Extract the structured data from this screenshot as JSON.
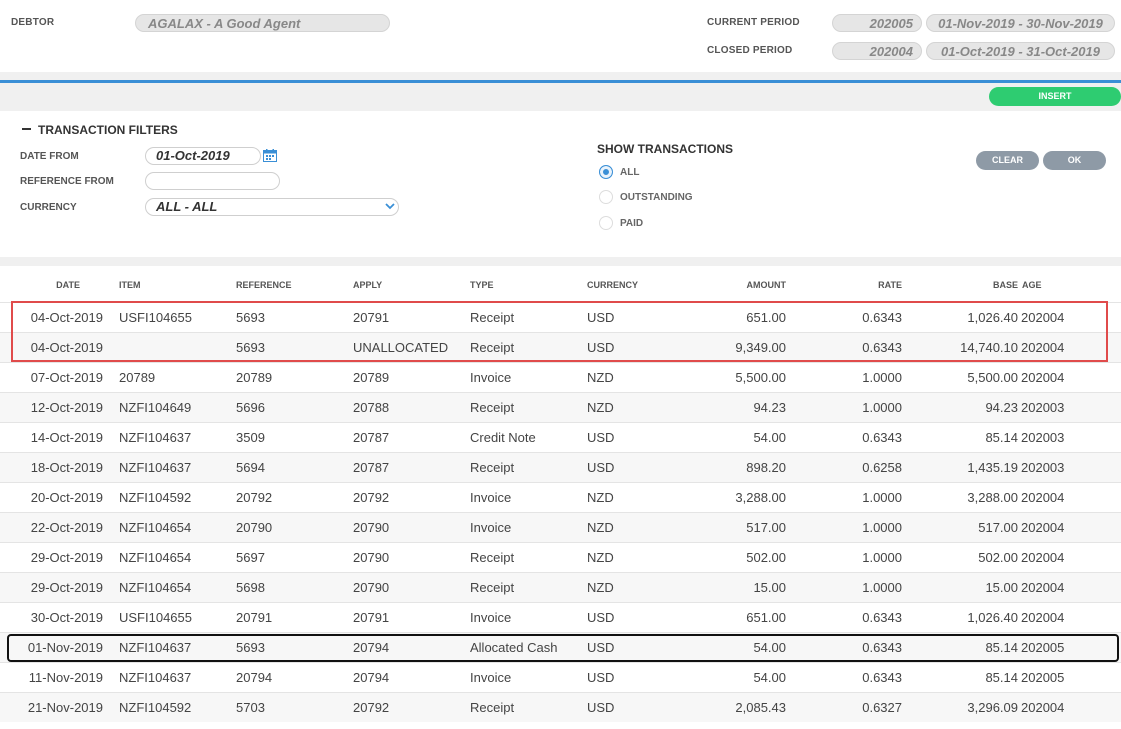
{
  "header": {
    "debtor_label": "DEBTOR",
    "debtor_value": "AGALAX - A Good Agent",
    "current_period_label": "CURRENT PERIOD",
    "current_period_code": "202005",
    "current_period_range": "01-Nov-2019 - 30-Nov-2019",
    "closed_period_label": "CLOSED PERIOD",
    "closed_period_code": "202004",
    "closed_period_range": "01-Oct-2019 - 31-Oct-2019"
  },
  "toolbar": {
    "insert_label": "INSERT"
  },
  "filters": {
    "title": "TRANSACTION FILTERS",
    "date_from_label": "DATE FROM",
    "date_from_value": "01-Oct-2019",
    "reference_from_label": "REFERENCE FROM",
    "reference_from_value": "",
    "currency_label": "CURRENCY",
    "currency_value": "ALL - ALL",
    "show_title": "SHOW TRANSACTIONS",
    "show_options": [
      {
        "label": "ALL",
        "selected": true
      },
      {
        "label": "OUTSTANDING",
        "selected": false
      },
      {
        "label": "PAID",
        "selected": false
      }
    ],
    "clear_label": "CLEAR",
    "ok_label": "OK"
  },
  "table": {
    "columns": [
      "DATE",
      "ITEM",
      "REFERENCE",
      "APPLY",
      "TYPE",
      "CURRENCY",
      "AMOUNT",
      "RATE",
      "BASE",
      "AGE"
    ],
    "rows": [
      [
        "04-Oct-2019",
        "USFI104655",
        "5693",
        "20791",
        "Receipt",
        "USD",
        "651.00",
        "0.6343",
        "1,026.40",
        "202004"
      ],
      [
        "04-Oct-2019",
        "",
        "5693",
        "UNALLOCATED",
        "Receipt",
        "USD",
        "9,349.00",
        "0.6343",
        "14,740.10",
        "202004"
      ],
      [
        "07-Oct-2019",
        "20789",
        "20789",
        "20789",
        "Invoice",
        "NZD",
        "5,500.00",
        "1.0000",
        "5,500.00",
        "202004"
      ],
      [
        "12-Oct-2019",
        "NZFI104649",
        "5696",
        "20788",
        "Receipt",
        "NZD",
        "94.23",
        "1.0000",
        "94.23",
        "202003"
      ],
      [
        "14-Oct-2019",
        "NZFI104637",
        "3509",
        "20787",
        "Credit Note",
        "USD",
        "54.00",
        "0.6343",
        "85.14",
        "202003"
      ],
      [
        "18-Oct-2019",
        "NZFI104637",
        "5694",
        "20787",
        "Receipt",
        "USD",
        "898.20",
        "0.6258",
        "1,435.19",
        "202003"
      ],
      [
        "20-Oct-2019",
        "NZFI104592",
        "20792",
        "20792",
        "Invoice",
        "NZD",
        "3,288.00",
        "1.0000",
        "3,288.00",
        "202004"
      ],
      [
        "22-Oct-2019",
        "NZFI104654",
        "20790",
        "20790",
        "Invoice",
        "NZD",
        "517.00",
        "1.0000",
        "517.00",
        "202004"
      ],
      [
        "29-Oct-2019",
        "NZFI104654",
        "5697",
        "20790",
        "Receipt",
        "NZD",
        "502.00",
        "1.0000",
        "502.00",
        "202004"
      ],
      [
        "29-Oct-2019",
        "NZFI104654",
        "5698",
        "20790",
        "Receipt",
        "NZD",
        "15.00",
        "1.0000",
        "15.00",
        "202004"
      ],
      [
        "30-Oct-2019",
        "USFI104655",
        "20791",
        "20791",
        "Invoice",
        "USD",
        "651.00",
        "0.6343",
        "1,026.40",
        "202004"
      ],
      [
        "01-Nov-2019",
        "NZFI104637",
        "5693",
        "20794",
        "Allocated Cash",
        "USD",
        "54.00",
        "0.6343",
        "85.14",
        "202005"
      ],
      [
        "11-Nov-2019",
        "NZFI104637",
        "20794",
        "20794",
        "Invoice",
        "USD",
        "54.00",
        "0.6343",
        "85.14",
        "202005"
      ],
      [
        "21-Nov-2019",
        "NZFI104592",
        "5703",
        "20792",
        "Receipt",
        "USD",
        "2,085.43",
        "0.6327",
        "3,296.09",
        "202004"
      ]
    ]
  },
  "colors": {
    "accent_blue": "#3a8fd6",
    "insert_green": "#2ecc71",
    "highlight_red": "#e04b4b",
    "highlight_black": "#111111",
    "button_gray": "#8e9aa6"
  },
  "icons": {
    "calendar": "calendar-icon",
    "dropdown": "chevron-down-icon",
    "collapse": "collapse-icon"
  }
}
